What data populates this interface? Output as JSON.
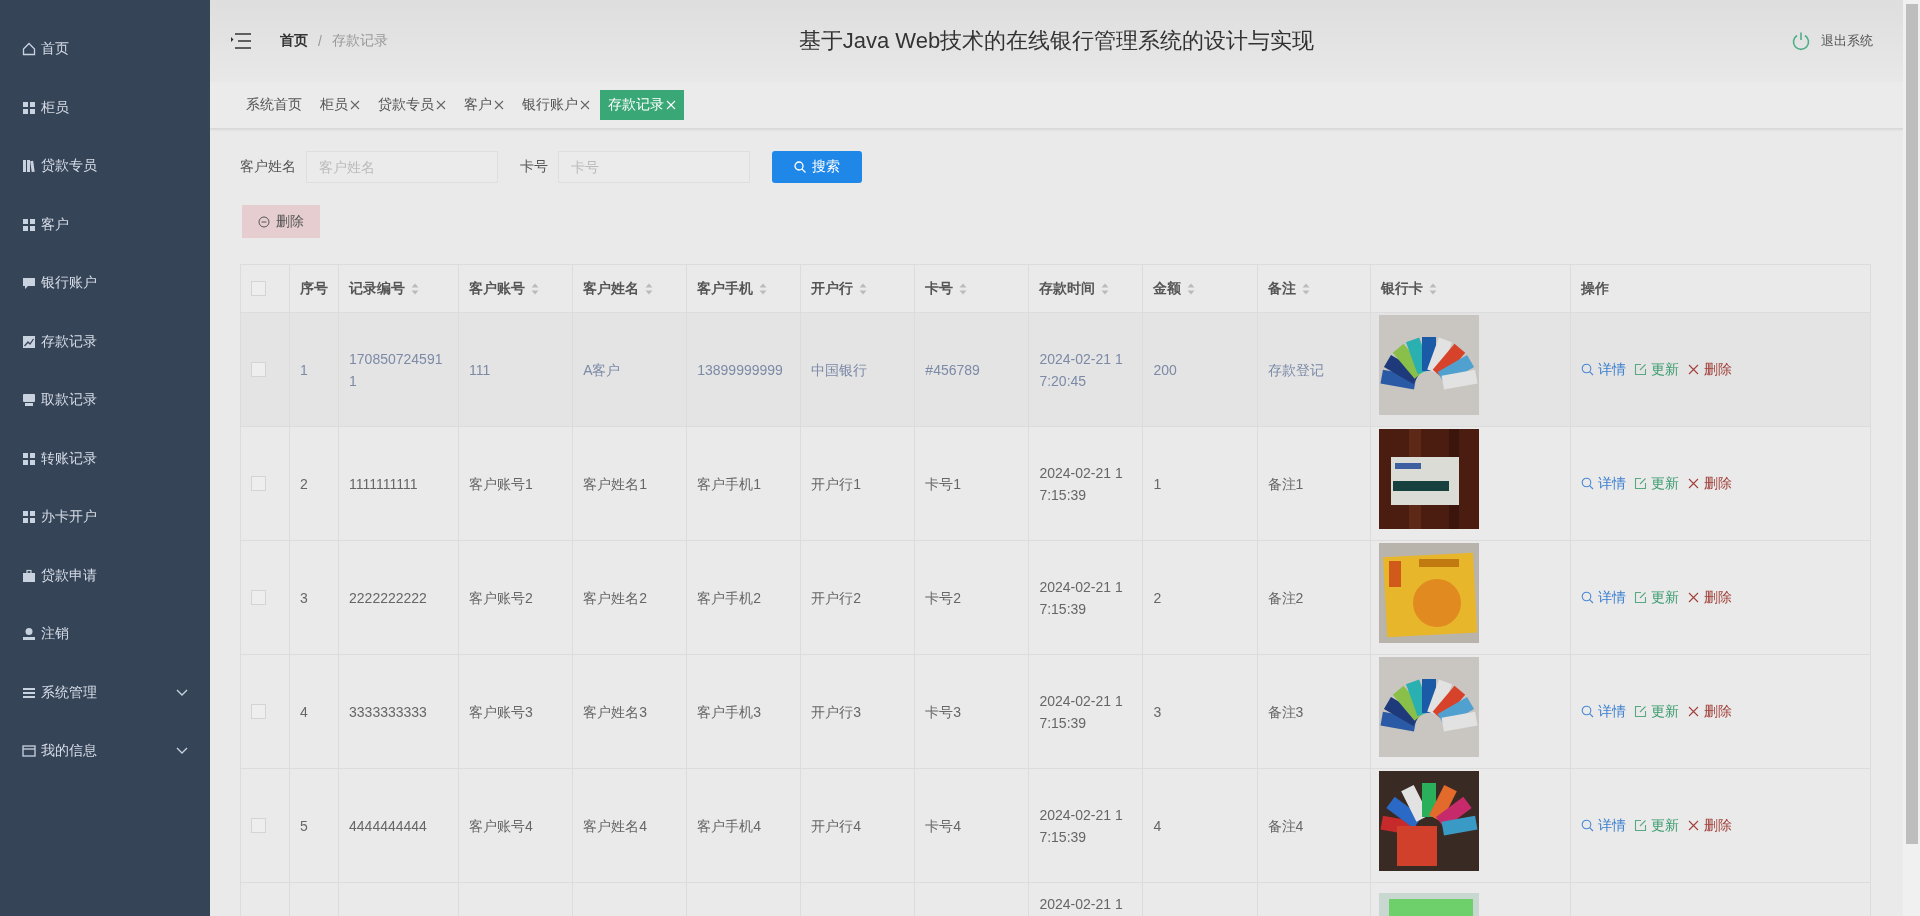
{
  "sidebar": {
    "items": [
      {
        "label": "首页",
        "kind": "link",
        "selected": false
      },
      {
        "label": "柜员",
        "kind": "link",
        "selected": false
      },
      {
        "label": "贷款专员",
        "kind": "link",
        "selected": false
      },
      {
        "label": "客户",
        "kind": "link",
        "selected": false
      },
      {
        "label": "银行账户",
        "kind": "link",
        "selected": false
      },
      {
        "label": "存款记录",
        "kind": "link",
        "selected": false
      },
      {
        "label": "取款记录",
        "kind": "link",
        "selected": false
      },
      {
        "label": "转账记录",
        "kind": "link",
        "selected": false
      },
      {
        "label": "办卡开户",
        "kind": "link",
        "selected": false
      },
      {
        "label": "贷款申请",
        "kind": "link",
        "selected": false
      },
      {
        "label": "注销",
        "kind": "link",
        "selected": false
      },
      {
        "label": "系统管理",
        "kind": "group",
        "selected": false,
        "expanded": false
      },
      {
        "label": "我的信息",
        "kind": "group",
        "selected": false,
        "expanded": false
      }
    ]
  },
  "header": {
    "breadcrumb": [
      "首页",
      "存款记录"
    ],
    "separator": "/",
    "title": "基于Java Web技术的在线银行管理系统的设计与实现",
    "logout": "退出系统"
  },
  "tabs": [
    {
      "label": "系统首页",
      "closable": false,
      "selected": false
    },
    {
      "label": "柜员",
      "closable": true,
      "selected": false
    },
    {
      "label": "贷款专员",
      "closable": true,
      "selected": false
    },
    {
      "label": "客户",
      "closable": true,
      "selected": false
    },
    {
      "label": "银行账户",
      "closable": true,
      "selected": false
    },
    {
      "label": "存款记录",
      "closable": true,
      "selected": true
    }
  ],
  "search": {
    "fields": [
      {
        "label": "客户姓名",
        "placeholder": "客户姓名"
      },
      {
        "label": "卡号",
        "placeholder": "卡号"
      }
    ],
    "button": "搜索"
  },
  "delete_button": "删除",
  "table": {
    "header_checkbox": {
      "checked": false
    },
    "columns": [
      {
        "label": "序号",
        "sortable": false
      },
      {
        "label": "记录编号",
        "sortable": true
      },
      {
        "label": "客户账号",
        "sortable": true
      },
      {
        "label": "客户姓名",
        "sortable": true
      },
      {
        "label": "客户手机",
        "sortable": true
      },
      {
        "label": "开户行",
        "sortable": true
      },
      {
        "label": "卡号",
        "sortable": true
      },
      {
        "label": "存款时间",
        "sortable": true
      },
      {
        "label": "金额",
        "sortable": true
      },
      {
        "label": "备注",
        "sortable": true
      },
      {
        "label": "银行卡",
        "sortable": true
      },
      {
        "label": "操作",
        "sortable": false
      }
    ],
    "rows": [
      {
        "checked": false,
        "highlighted": true,
        "seq": "1",
        "record_no": "1708507245911",
        "account": "111",
        "customer": "A客户",
        "phone": "13899999999",
        "bank": "中国银行",
        "card": "#456789",
        "time": "2024-02-21 17:20:45",
        "amount": "200",
        "note": "存款登记",
        "actions": [
          {
            "kind": "view",
            "label": "详情"
          },
          {
            "kind": "edit",
            "label": "更新"
          },
          {
            "kind": "delete",
            "label": "删除"
          }
        ]
      },
      {
        "checked": false,
        "highlighted": false,
        "seq": "2",
        "record_no": "1111111111",
        "account": "客户账号1",
        "customer": "客户姓名1",
        "phone": "客户手机1",
        "bank": "开户行1",
        "card": "卡号1",
        "time": "2024-02-21 17:15:39",
        "amount": "1",
        "note": "备注1",
        "actions": [
          {
            "kind": "view",
            "label": "详情"
          },
          {
            "kind": "edit",
            "label": "更新"
          },
          {
            "kind": "delete",
            "label": "删除"
          }
        ]
      },
      {
        "checked": false,
        "highlighted": false,
        "seq": "3",
        "record_no": "2222222222",
        "account": "客户账号2",
        "customer": "客户姓名2",
        "phone": "客户手机2",
        "bank": "开户行2",
        "card": "卡号2",
        "time": "2024-02-21 17:15:39",
        "amount": "2",
        "note": "备注2",
        "actions": [
          {
            "kind": "view",
            "label": "详情"
          },
          {
            "kind": "edit",
            "label": "更新"
          },
          {
            "kind": "delete",
            "label": "删除"
          }
        ]
      },
      {
        "checked": false,
        "highlighted": false,
        "seq": "4",
        "record_no": "3333333333",
        "account": "客户账号3",
        "customer": "客户姓名3",
        "phone": "客户手机3",
        "bank": "开户行3",
        "card": "卡号3",
        "time": "2024-02-21 17:15:39",
        "amount": "3",
        "note": "备注3",
        "actions": [
          {
            "kind": "view",
            "label": "详情"
          },
          {
            "kind": "edit",
            "label": "更新"
          },
          {
            "kind": "delete",
            "label": "删除"
          }
        ]
      },
      {
        "checked": false,
        "highlighted": false,
        "seq": "5",
        "record_no": "4444444444",
        "account": "客户账号4",
        "customer": "客户姓名4",
        "phone": "客户手机4",
        "bank": "开户行4",
        "card": "卡号4",
        "time": "2024-02-21 17:15:39",
        "amount": "4",
        "note": "备注4",
        "actions": [
          {
            "kind": "view",
            "label": "详情"
          },
          {
            "kind": "edit",
            "label": "更新"
          },
          {
            "kind": "delete",
            "label": "删除"
          }
        ]
      },
      {
        "highlighted": false,
        "time": "2024-02-21 1"
      }
    ]
  }
}
